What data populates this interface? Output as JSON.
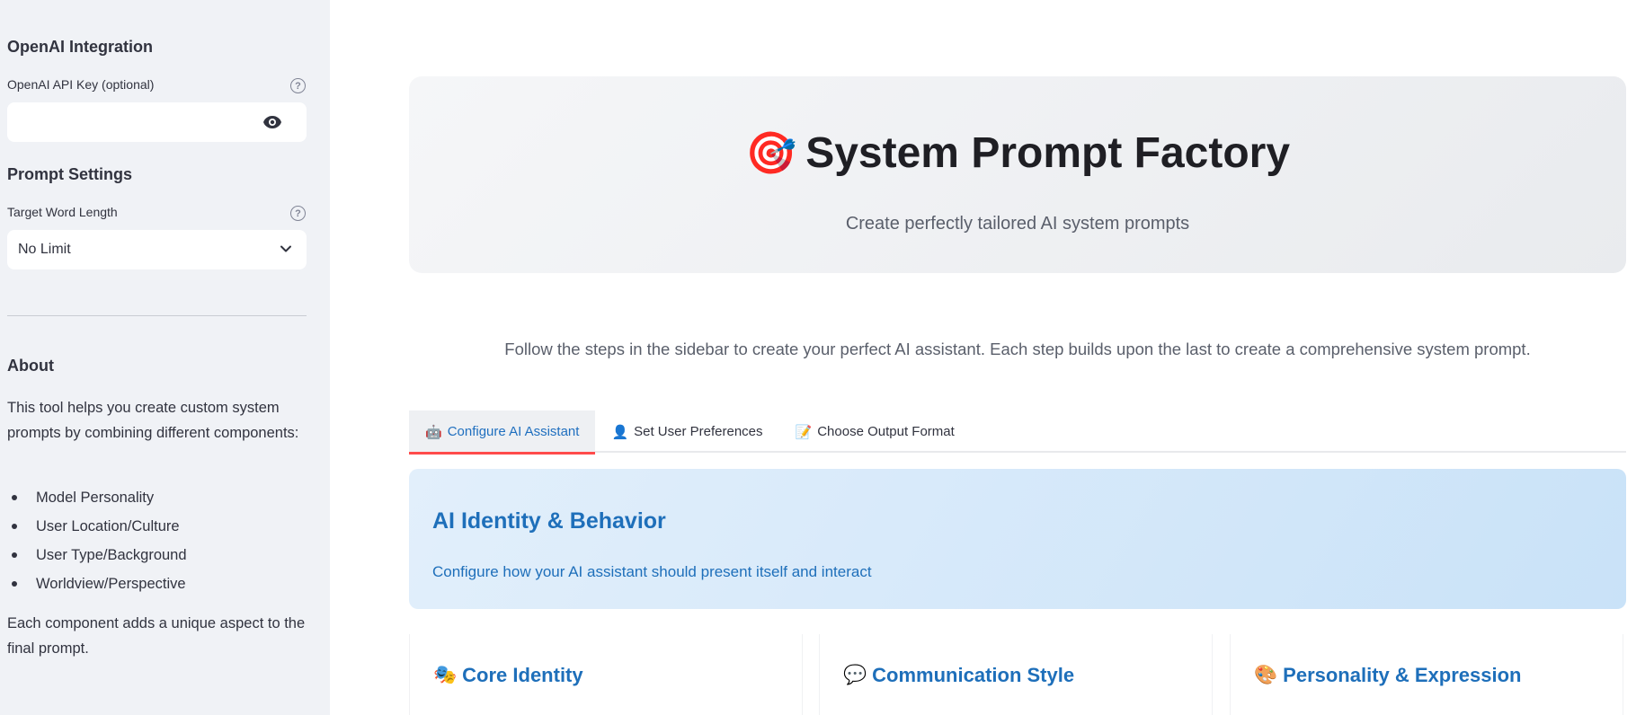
{
  "sidebar": {
    "openai_heading": "OpenAI Integration",
    "api_key_label": "OpenAI API Key (optional)",
    "api_key_value": "",
    "api_key_icon": "eye-icon",
    "prompt_settings_heading": "Prompt Settings",
    "word_length_label": "Target Word Length",
    "word_length_value": "No Limit",
    "about_heading": "About",
    "about_text": "This tool helps you create custom system prompts by combining different components:",
    "components": [
      "Model Personality",
      "User Location/Culture",
      "User Type/Background",
      "Worldview/Perspective"
    ],
    "about_footer": "Each component adds a unique aspect to the final prompt."
  },
  "hero": {
    "emoji": "🎯",
    "title": "System Prompt Factory",
    "subtitle": "Create perfectly tailored AI system prompts"
  },
  "intro": "Follow the steps in the sidebar to create your perfect AI assistant. Each step builds upon the last to create a comprehensive system prompt.",
  "tabs": [
    {
      "emoji": "🤖",
      "label": "Configure AI Assistant",
      "active": true
    },
    {
      "emoji": "👤",
      "label": "Set User Preferences",
      "active": false
    },
    {
      "emoji": "📝",
      "label": "Choose Output Format",
      "active": false
    }
  ],
  "section": {
    "title": "AI Identity & Behavior",
    "description": "Configure how your AI assistant should present itself and interact"
  },
  "columns": [
    {
      "emoji": "🎭",
      "title": "Core Identity"
    },
    {
      "emoji": "💬",
      "title": "Communication Style"
    },
    {
      "emoji": "🎨",
      "title": "Personality & Expression"
    }
  ],
  "colors": {
    "sidebar_bg": "#f0f2f6",
    "accent_blue": "#1e6fba",
    "tab_underline": "#ff4b4b"
  }
}
